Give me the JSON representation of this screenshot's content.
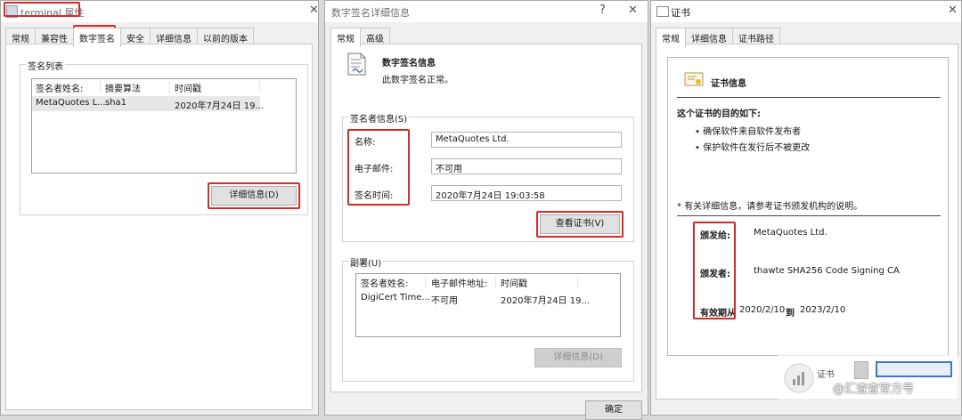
{
  "w1": {
    "title": "terminal 属性",
    "tabs": [
      "常规",
      "兼容性",
      "数字签名",
      "安全",
      "详细信息",
      "以前的版本"
    ],
    "group_label": "签名列表",
    "columns": [
      "签名者姓名:",
      "摘要算法",
      "时间戳"
    ],
    "row": [
      "MetaQuotes L...",
      "sha1",
      "2020年7月24日 19..."
    ],
    "details_button": "详细信息(D)"
  },
  "w2": {
    "title": "数字签名详细信息",
    "help": "?",
    "tabs": [
      "常规",
      "高级"
    ],
    "heading": "数字签名信息",
    "status": "此数字签名正常。",
    "signer_group": "签名者信息(S)",
    "name_label": "名称:",
    "name_value": "MetaQuotes Ltd.",
    "email_label": "电子邮件:",
    "email_value": "不可用",
    "time_label": "签名时间:",
    "time_value": "2020年7月24日 19:03:58",
    "view_cert_button": "查看证书(V)",
    "countersig_group": "副署(U)",
    "columns": [
      "签名者姓名:",
      "电子邮件地址:",
      "时间戳"
    ],
    "row": [
      "DigiCert Time...",
      "不可用",
      "2020年7月24日 19..."
    ],
    "details_button": "详细信息(D)",
    "ok_button": "确定"
  },
  "w3": {
    "title": "证书",
    "tabs": [
      "常规",
      "详细信息",
      "证书路径"
    ],
    "heading": "证书信息",
    "purpose_title": "这个证书的目的如下:",
    "purposes": [
      "• 确保软件来自软件发布者",
      "• 保护软件在发行后不被更改"
    ],
    "note": "* 有关详细信息，请参考证书颁发机构的说明。",
    "issued_to_label": "颁发给:",
    "issued_to_value": "MetaQuotes Ltd.",
    "issued_by_label": "颁发者:",
    "issued_by_value": "thawte SHA256 Code Signing CA",
    "valid_label": "有效期从",
    "valid_from": "2020/2/10",
    "valid_to_word": "到",
    "valid_to": "2023/2/10",
    "bottom_partial": "证书",
    "watermark": "@汇查查官方号"
  },
  "colors": {
    "highlight": "#d62b2b",
    "window_bg": "#f0f0f0",
    "panel_bg": "#ffffff"
  }
}
